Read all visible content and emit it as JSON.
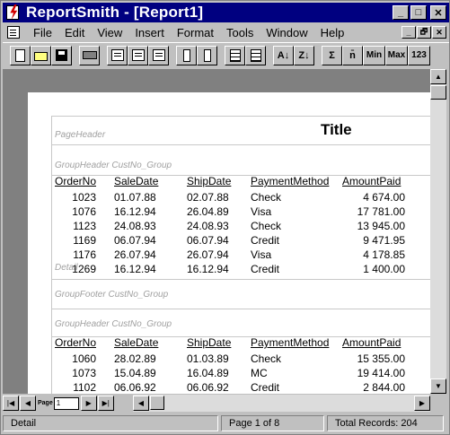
{
  "window": {
    "title": "ReportSmith - [Report1]",
    "controls": [
      "_",
      "□",
      "✕"
    ]
  },
  "menu": {
    "items": [
      {
        "label": "File"
      },
      {
        "label": "Edit"
      },
      {
        "label": "View"
      },
      {
        "label": "Insert"
      },
      {
        "label": "Format"
      },
      {
        "label": "Tools"
      },
      {
        "label": "Window"
      },
      {
        "label": "Help"
      }
    ],
    "mdi_controls": [
      "_",
      "🗗",
      "✕"
    ]
  },
  "toolbar": {
    "buttons": [
      {
        "name": "new-report-icon"
      },
      {
        "name": "open-icon"
      },
      {
        "name": "save-icon"
      },
      {
        "name": "print-icon"
      },
      {
        "name": "header-icon"
      },
      {
        "name": "lines-icon"
      },
      {
        "name": "footer-icon"
      },
      {
        "name": "column-icon"
      },
      {
        "name": "rows-icon"
      },
      {
        "name": "calculator-icon"
      },
      {
        "name": "table-icon"
      },
      {
        "name": "sort-ascending-icon",
        "label": "A↓"
      },
      {
        "name": "sort-descending-icon",
        "label": "Z↓"
      },
      {
        "name": "sum-icon",
        "label": "Σ"
      },
      {
        "name": "average-icon",
        "label": "n̄"
      },
      {
        "name": "min-icon",
        "label": "Min"
      },
      {
        "name": "max-icon",
        "label": "Max"
      },
      {
        "name": "count-icon",
        "label": "123"
      }
    ]
  },
  "report": {
    "bands": {
      "page_header": "PageHeader",
      "group_header": "GroupHeader CustNo_Group",
      "detail": "Detail",
      "group_footer": "GroupFooter CustNo_Group",
      "group_header_2": "GroupHeader CustNo_Group"
    },
    "title": "Title",
    "columns": [
      "OrderNo",
      "SaleDate",
      "ShipDate",
      "PaymentMethod",
      "AmountPaid"
    ],
    "group1_rows": [
      [
        "1023",
        "01.07.88",
        "02.07.88",
        "Check",
        "4 674.00"
      ],
      [
        "1076",
        "16.12.94",
        "26.04.89",
        "Visa",
        "17 781.00"
      ],
      [
        "1123",
        "24.08.93",
        "24.08.93",
        "Check",
        "13 945.00"
      ],
      [
        "1169",
        "06.07.94",
        "06.07.94",
        "Credit",
        "9 471.95"
      ],
      [
        "1176",
        "26.07.94",
        "26.07.94",
        "Visa",
        "4 178.85"
      ],
      [
        "1269",
        "16.12.94",
        "16.12.94",
        "Credit",
        "1 400.00"
      ]
    ],
    "group2_rows": [
      [
        "1060",
        "28.02.89",
        "01.03.89",
        "Check",
        "15 355.00"
      ],
      [
        "1073",
        "15.04.89",
        "16.04.89",
        "MC",
        "19 414.00"
      ],
      [
        "1102",
        "06.06.92",
        "06.06.92",
        "Credit",
        "2 844.00"
      ]
    ]
  },
  "navigator": {
    "page_label": "Page",
    "page_value": "1"
  },
  "status": {
    "section": "Detail",
    "page": "Page  1 of  8",
    "records": "Total Records:    204"
  }
}
